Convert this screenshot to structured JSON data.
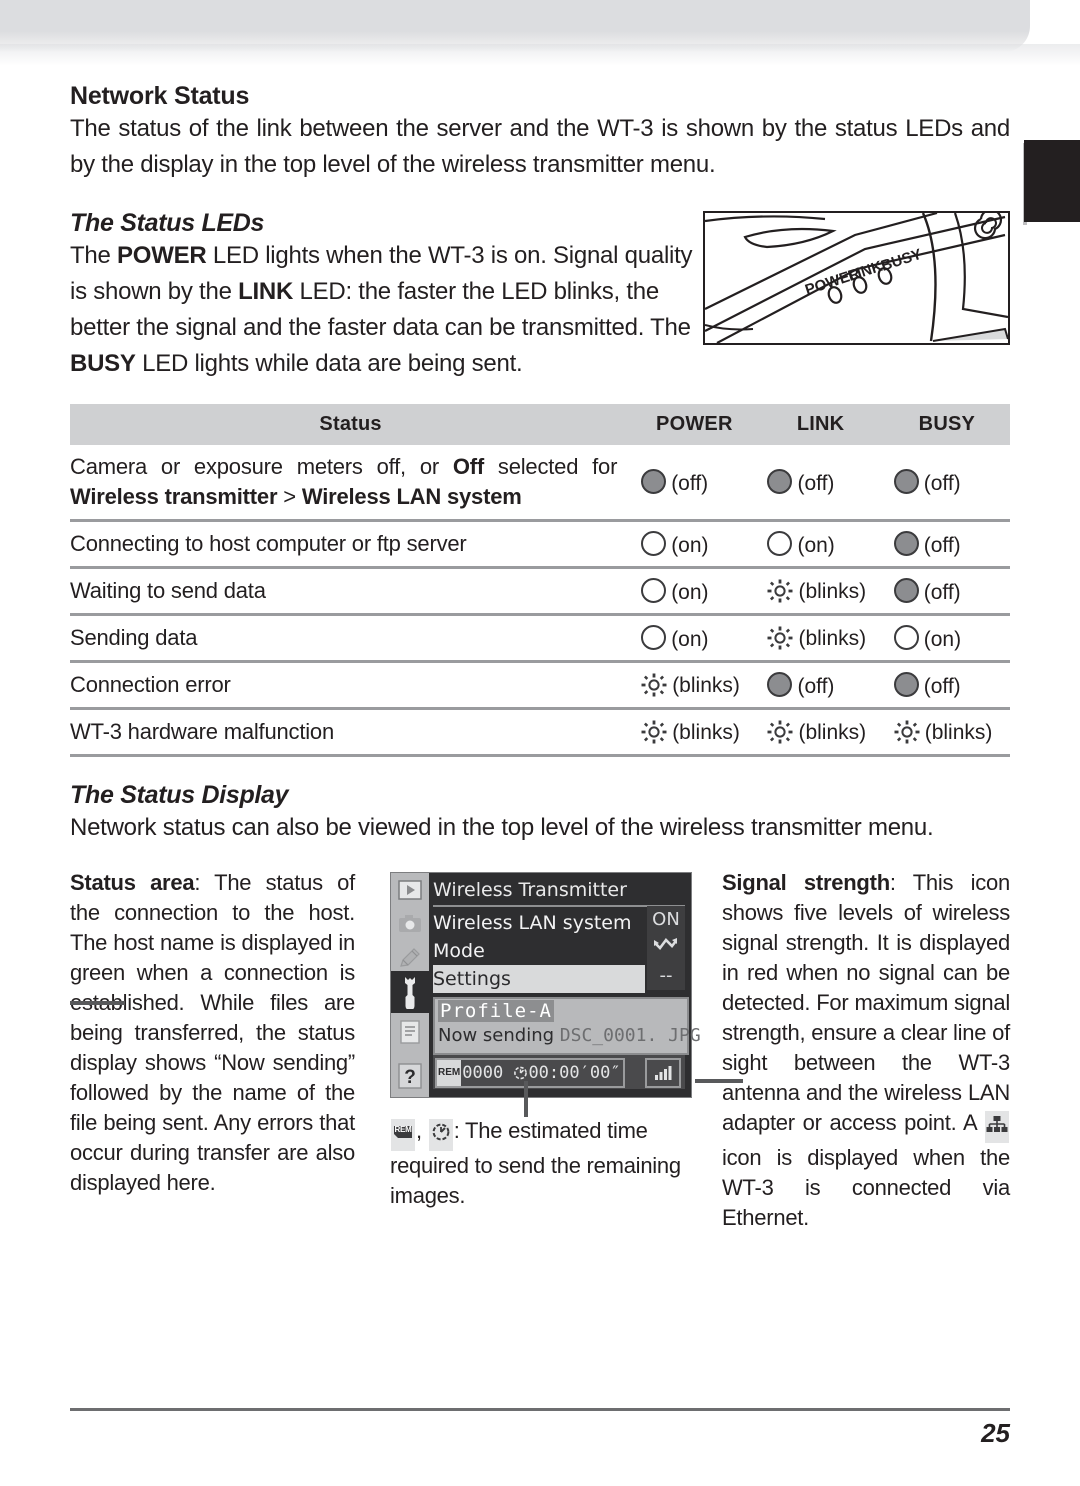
{
  "section": {
    "title": "Network Status",
    "intro": "The status of the link between the server and the WT-3 is shown by the status LEDs and by the display in the top level of the wireless transmitter menu."
  },
  "leds": {
    "heading": "The Status LEDs",
    "paragraph_parts": {
      "p1": "The ",
      "b1": "POWER",
      "p2": " LED lights when the WT-3 is on.  Signal quality is shown by the ",
      "b2": "LINK",
      "p3": " LED: the faster the LED blinks, the better the signal and the faster data can be transmitted.  The ",
      "b3": "BUSY",
      "p4": " LED lights while data are being sent."
    },
    "device_labels": {
      "power": "POWER",
      "link": "LINK",
      "busy": "BUSY"
    },
    "table": {
      "headers": [
        "Status",
        "POWER",
        "LINK",
        "BUSY"
      ],
      "rows": [
        {
          "status_pre": "Camera  or  exposure  meters  off,  or  ",
          "status_bold1": "Off",
          "status_mid": "  selected  for",
          "status_bold2": "Wireless transmitter",
          "status_sep": " > ",
          "status_bold3": "Wireless LAN system",
          "power": {
            "state": "off",
            "label": "(off)"
          },
          "link": {
            "state": "off",
            "label": "(off)"
          },
          "busy": {
            "state": "off",
            "label": "(off)"
          }
        },
        {
          "status": "Connecting to host computer or ftp server",
          "power": {
            "state": "on",
            "label": "(on)"
          },
          "link": {
            "state": "on",
            "label": "(on)"
          },
          "busy": {
            "state": "off",
            "label": "(off)"
          }
        },
        {
          "status": "Waiting to send data",
          "power": {
            "state": "on",
            "label": "(on)"
          },
          "link": {
            "state": "blinks",
            "label": "(blinks)"
          },
          "busy": {
            "state": "off",
            "label": "(off)"
          }
        },
        {
          "status": "Sending data",
          "power": {
            "state": "on",
            "label": "(on)"
          },
          "link": {
            "state": "blinks",
            "label": "(blinks)"
          },
          "busy": {
            "state": "on",
            "label": "(on)"
          }
        },
        {
          "status": "Connection error",
          "power": {
            "state": "blinks",
            "label": "(blinks)"
          },
          "link": {
            "state": "off",
            "label": "(off)"
          },
          "busy": {
            "state": "off",
            "label": "(off)"
          }
        },
        {
          "status": "WT-3 hardware malfunction",
          "power": {
            "state": "blinks",
            "label": "(blinks)"
          },
          "link": {
            "state": "blinks",
            "label": "(blinks)"
          },
          "busy": {
            "state": "blinks",
            "label": "(blinks)"
          }
        }
      ]
    }
  },
  "status_display": {
    "heading": "The Status Display",
    "intro": "Network status can also be viewed in the top level of the wireless transmitter menu.",
    "left_note": {
      "bold": "Status area",
      "text": ": The status of the connection to the host. The host name is displayed in green when a connection is established.  While files are being transferred, the status display shows “Now sending” followed by the name of the file being sent. Any errors that occur during transfer are also displayed here."
    },
    "right_note": {
      "bold": "Signal strength",
      "text_a": ": This icon shows five levels of wireless signal strength.  It is displayed in red when no signal can be detected. For maximum signal strength, ensure a clear line of sight between the WT-3 antenna and the wireless LAN adapter or access point. A ",
      "text_b": " icon is displayed when the WT-3 is connected via Ethernet."
    },
    "mid_caption": {
      "text": ": The estimated time required to send the remaining images."
    },
    "lcd": {
      "title": "Wireless Transmitter",
      "menu_rows": [
        {
          "label": "Wireless LAN system",
          "value": "ON",
          "selected": false
        },
        {
          "label": "Mode",
          "value": "mode-arrow-icon",
          "selected": false
        },
        {
          "label": "Settings",
          "value": "--",
          "selected": true
        }
      ],
      "values": [
        "ON",
        "--"
      ],
      "status_area": {
        "profile": "Profile-A",
        "sending_label": "Now sending",
        "filename": "DSC_0001. JPG"
      },
      "bottom_bar": {
        "rem_badge": "REM",
        "frames": "0000",
        "time": "00:00′00″",
        "signal_icon": "signal-bars-icon"
      },
      "side_icons": [
        "playback-icon",
        "shooting-menu-icon",
        "retouch-icon",
        "setup-wrench-icon",
        "my-menu-icon",
        "help-icon"
      ]
    }
  },
  "footer": {
    "page_number": "25"
  }
}
